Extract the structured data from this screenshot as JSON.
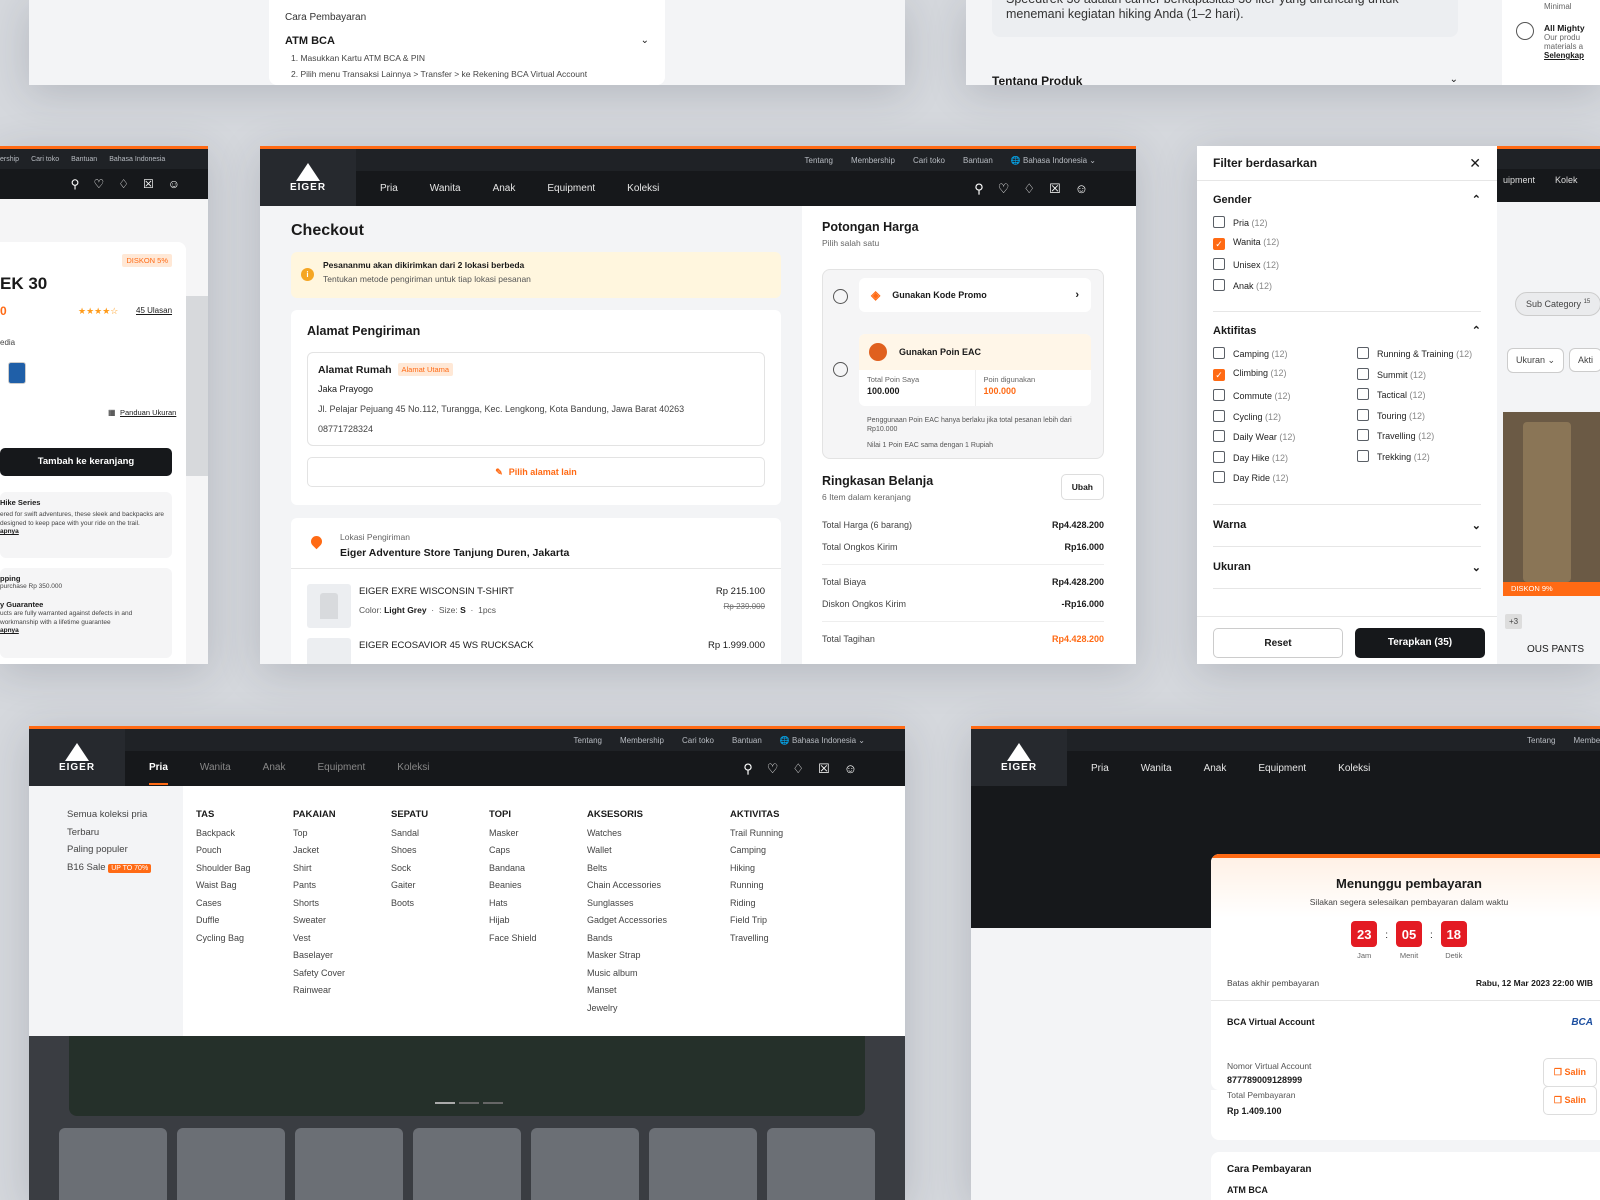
{
  "nav": {
    "top_links": [
      "Tentang",
      "Membership",
      "Cari toko",
      "Bantuan",
      "Bahasa Indonesia"
    ],
    "brand": "EIGER",
    "menu": [
      "Pria",
      "Wanita",
      "Anak",
      "Equipment",
      "Koleksi"
    ]
  },
  "top_left_card": {
    "title": "Cara Pembayaran",
    "method": "ATM BCA",
    "steps": [
      "1. Masukkan Kartu ATM BCA & PIN",
      "2. Pilih menu Transaksi Lainnya > Transfer > ke Rekening BCA Virtual Account"
    ]
  },
  "top_right_card": {
    "desc": "Speedtrek 30 adalah carrier berkapasitas 30 liter yang dirancang untuk menemani kegiatan hiking Anda (1–2 hari).",
    "about": "Tentang Produk",
    "side1": "Minimal",
    "side2": "All Mighty",
    "side3": "Our produ materials a",
    "side4": "Selengkap"
  },
  "product_card": {
    "top_links": [
      "ership",
      "Cari toko",
      "Bantuan",
      "Bahasa Indonesia"
    ],
    "discount": "DISKON 5%",
    "name": "EK 30",
    "price": "0",
    "reviews": "45 Ulasan",
    "media": "edia",
    "size_guide": "Panduan Ukuran",
    "add_to_cart": "Tambah ke keranjang",
    "series_title": "Hike Series",
    "series_desc": "ered for swift adventures, these sleek and backpacks are designed to keep pace with your ride on the trail.",
    "link": "apnya",
    "ship_title": "pping",
    "ship_desc": "purchase Rp 350.000",
    "guarantee_title": "y Guarantee",
    "guarantee_desc": "ucts are fully warranted against defects in and workmanship with a lifetime guarantee",
    "link2": "apnya"
  },
  "checkout": {
    "title": "Checkout",
    "notice_title": "Pesananmu akan dikirimkan dari 2 lokasi berbeda",
    "notice_sub": "Tentukan metode pengiriman untuk tiap lokasi pesanan",
    "address_section": "Alamat Pengiriman",
    "address_name": "Alamat Rumah",
    "address_badge": "Alamat Utama",
    "recipient": "Jaka Prayogo",
    "address": "Jl. Pelajar Pejuang 45 No.112, Turangga, Kec. Lengkong, Kota Bandung, Jawa Barat 40263",
    "phone": "08771728324",
    "change_address": "Pilih alamat lain",
    "location_label": "Lokasi Pengiriman",
    "location_name": "Eiger Adventure Store Tanjung Duren, Jakarta",
    "item1_name": "EIGER EXRE WISCONSIN T-SHIRT",
    "item1_color_label": "Color:",
    "item1_color": "Light Grey",
    "item1_size_label": "Size:",
    "item1_size": "S",
    "item1_qty": "1pcs",
    "item1_price": "Rp 215.100",
    "item1_old": "Rp 239.000",
    "item2_name": "EIGER ECOSAVIOR 45 WS RUCKSACK",
    "item2_price": "Rp 1.999.000"
  },
  "discount": {
    "title": "Potongan Harga",
    "subtitle": "Pilih salah satu",
    "promo": "Gunakan Kode Promo",
    "points": "Gunakan Poin EAC",
    "total_points_label": "Total Poin Saya",
    "total_points": "100.000",
    "used_points_label": "Poin digunakan",
    "used_points": "100.000",
    "note1": "Penggunaan Poin EAC hanya berlaku jika total pesanan lebih dari Rp10.000",
    "note2": "Nilai 1 Poin EAC sama dengan 1 Rupiah"
  },
  "summary": {
    "title": "Ringkasan Belanja",
    "subtitle": "6 Item dalam keranjang",
    "edit": "Ubah",
    "rows": [
      {
        "label": "Total Harga (6 barang)",
        "value": "Rp4.428.200"
      },
      {
        "label": "Total Ongkos Kirim",
        "value": "Rp16.000"
      },
      {
        "label": "Total Biaya",
        "value": "Rp4.428.200"
      },
      {
        "label": "Diskon Ongkos Kirim",
        "value": "-Rp16.000"
      }
    ],
    "total_label": "Total Tagihan",
    "total_value": "Rp4.428.200"
  },
  "filter": {
    "title": "Filter berdasarkan",
    "gender_title": "Gender",
    "gender": [
      {
        "label": "Pria",
        "count": "(12)",
        "checked": false
      },
      {
        "label": "Wanita",
        "count": "(12)",
        "checked": true
      },
      {
        "label": "Unisex",
        "count": "(12)",
        "checked": false
      },
      {
        "label": "Anak",
        "count": "(12)",
        "checked": false
      }
    ],
    "activity_title": "Aktifitas",
    "activity_left": [
      {
        "label": "Camping",
        "count": "(12)",
        "checked": false
      },
      {
        "label": "Climbing",
        "count": "(12)",
        "checked": true
      },
      {
        "label": "Commute",
        "count": "(12)",
        "checked": false
      },
      {
        "label": "Cycling",
        "count": "(12)",
        "checked": false
      },
      {
        "label": "Daily Wear",
        "count": "(12)",
        "checked": false
      },
      {
        "label": "Day Hike",
        "count": "(12)",
        "checked": false
      },
      {
        "label": "Day Ride",
        "count": "(12)",
        "checked": false
      }
    ],
    "activity_right": [
      {
        "label": "Running & Training",
        "count": "(12)",
        "checked": false
      },
      {
        "label": "Summit",
        "count": "(12)",
        "checked": false
      },
      {
        "label": "Tactical",
        "count": "(12)",
        "checked": false
      },
      {
        "label": "Touring",
        "count": "(12)",
        "checked": false
      },
      {
        "label": "Travelling",
        "count": "(12)",
        "checked": false
      },
      {
        "label": "Trekking",
        "count": "(12)",
        "checked": false
      }
    ],
    "color_title": "Warna",
    "size_title": "Ukuran",
    "reset": "Reset",
    "apply": "Terapkan (35)"
  },
  "listing": {
    "menu": [
      "uipment",
      "Kolek"
    ],
    "sub_category": "Sub Category",
    "sub_count": "15",
    "size": "Ukuran",
    "aktif": "Akti",
    "discount": "DISKON 9%",
    "more": "+3",
    "name": "OUS PANTS"
  },
  "megamenu": {
    "side": [
      "Semua koleksi pria",
      "Terbaru",
      "Paling populer",
      "B16 Sale"
    ],
    "sale_badge": "UP TO 70%",
    "columns": [
      {
        "h": "TAS",
        "items": [
          "Backpack",
          "Pouch",
          "Shoulder Bag",
          "Waist Bag",
          "Cases",
          "Duffle",
          "Cycling Bag"
        ]
      },
      {
        "h": "PAKAIAN",
        "items": [
          "Top",
          "Jacket",
          "Shirt",
          "Pants",
          "Shorts",
          "Sweater",
          "Vest",
          "Baselayer",
          "Safety Cover",
          "Rainwear"
        ]
      },
      {
        "h": "SEPATU",
        "items": [
          "Sandal",
          "Shoes",
          "Sock",
          "Gaiter",
          "Boots"
        ]
      },
      {
        "h": "TOPI",
        "items": [
          "Masker",
          "Caps",
          "Bandana",
          "Beanies",
          "Hats",
          "Hijab",
          "Face Shield"
        ]
      },
      {
        "h": "AKSESORIS",
        "items": [
          "Watches",
          "Wallet",
          "Belts",
          "Chain Accessories",
          "Sunglasses",
          "Gadget Accessories",
          "Bands",
          "Masker Strap",
          "Music album",
          "Manset",
          "Jewelry"
        ]
      },
      {
        "h": "AKTIVITAS",
        "items": [
          "Trail Running",
          "Camping",
          "Hiking",
          "Running",
          "Riding",
          "Field Trip",
          "Travelling"
        ]
      }
    ]
  },
  "payment": {
    "top_links": [
      "Tentang",
      "Membe"
    ],
    "title": "Menunggu pembayaran",
    "subtitle": "Silakan segera selesaikan pembayaran dalam waktu",
    "hours": "23",
    "minutes": "05",
    "seconds": "18",
    "hours_label": "Jam",
    "minutes_label": "Menit",
    "seconds_label": "Detik",
    "deadline_label": "Batas akhir pembayaran",
    "deadline": "Rabu, 12 Mar 2023 22:00 WIB",
    "bank": "BCA Virtual Account",
    "bank_logo": "BCA",
    "va_label": "Nomor Virtual Account",
    "va": "877789009128999",
    "total_label": "Total Pembayaran",
    "total": "Rp 1.409.100",
    "copy": "Salin",
    "how_title": "Cara Pembayaran",
    "how_method": "ATM BCA"
  },
  "colors": {
    "accent": "#ff6a14",
    "dark": "#16181b",
    "danger": "#e31b23"
  }
}
